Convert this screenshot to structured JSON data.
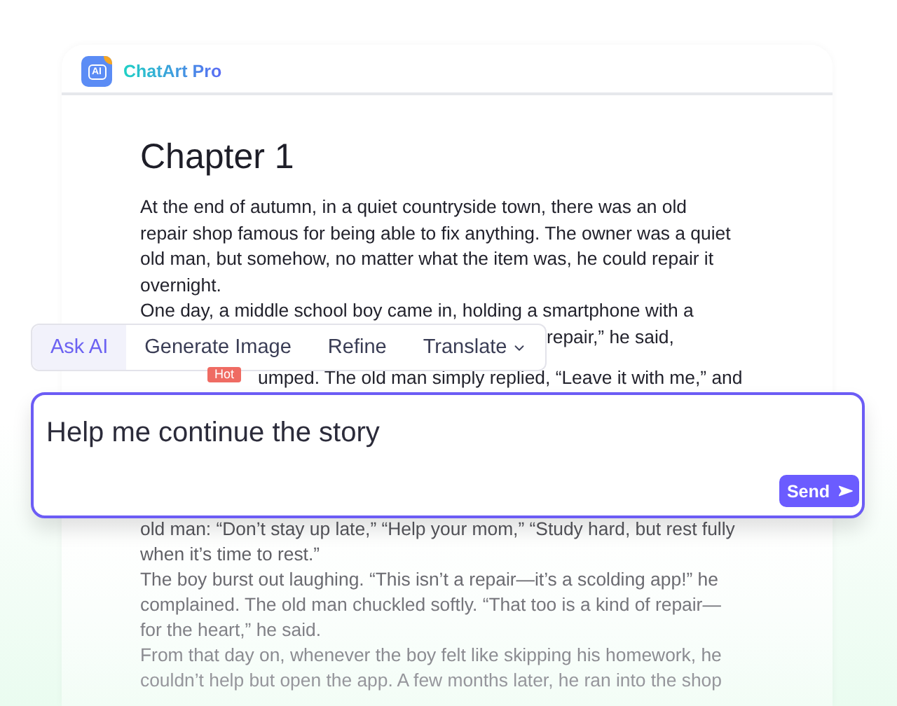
{
  "app": {
    "logo_mark": "AI",
    "name": "ChatArt Pro"
  },
  "document": {
    "title": "Chapter 1",
    "lines_above": [
      "At the end of autumn, in a quiet countryside town, there was an old",
      "repair shop famous for being able to fix anything. The owner was a quiet",
      "old man, but somehow, no matter what the item was, he could repair it",
      "overnight.",
      "One day, a middle school boy came in, holding a smartphone with a"
    ],
    "line_beside_toolbar": "repair,” he said,",
    "line_under_toolbar": "umped. The old man simply replied, “Leave it with me,” and",
    "lines_below": [
      "old man: “Don’t stay up late,” “Help your mom,” “Study hard, but rest fully",
      "when it’s time to rest.”",
      "The boy burst out laughing. “This isn’t a repair—it’s a scolding app!” he",
      "complained. The old man chuckled softly. “That too is a kind of repair—",
      "for the heart,” he said.",
      "From that day on, whenever the boy felt like skipping his homework, he",
      "couldn’t help but open the app. A few months later, he ran into the shop"
    ]
  },
  "toolbar": {
    "tabs": [
      {
        "label": "Ask AI",
        "selected": true
      },
      {
        "label": "Generate Image",
        "selected": false,
        "badge": "Hot"
      },
      {
        "label": "Refine",
        "selected": false
      },
      {
        "label": "Translate",
        "selected": false,
        "dropdown": true
      }
    ]
  },
  "prompt": {
    "value": "Help me continue the story",
    "send_label": "Send"
  }
}
